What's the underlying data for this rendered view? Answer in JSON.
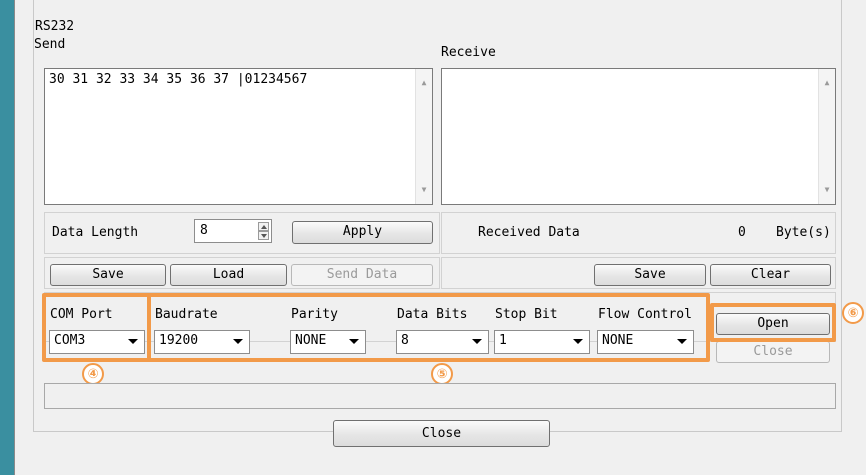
{
  "group_title": "RS232",
  "send": {
    "label": "Send",
    "text": "30 31 32 33 34 35 36 37 |01234567"
  },
  "receive": {
    "label": "Receive",
    "text": ""
  },
  "data_length": {
    "label": "Data Length",
    "value": "8",
    "apply_label": "Apply"
  },
  "received_data": {
    "label": "Received Data",
    "count": "0",
    "unit": "Byte(s)"
  },
  "send_buttons": {
    "save": "Save",
    "load": "Load",
    "send_data": "Send Data"
  },
  "receive_buttons": {
    "save": "Save",
    "clear": "Clear"
  },
  "settings": {
    "com_port": {
      "label": "COM Port",
      "value": "COM3"
    },
    "baudrate": {
      "label": "Baudrate",
      "value": "19200"
    },
    "parity": {
      "label": "Parity",
      "value": "NONE"
    },
    "data_bits": {
      "label": "Data Bits",
      "value": "8"
    },
    "stop_bit": {
      "label": "Stop Bit",
      "value": "1"
    },
    "flow_control": {
      "label": "Flow Control",
      "value": "NONE"
    }
  },
  "port_buttons": {
    "open": "Open",
    "close": "Close"
  },
  "callouts": {
    "four": "④",
    "five": "⑤",
    "six": "⑥"
  },
  "close_button": "Close",
  "colors": {
    "highlight": "#f29a49",
    "left_bar": "#3a8fa0"
  }
}
